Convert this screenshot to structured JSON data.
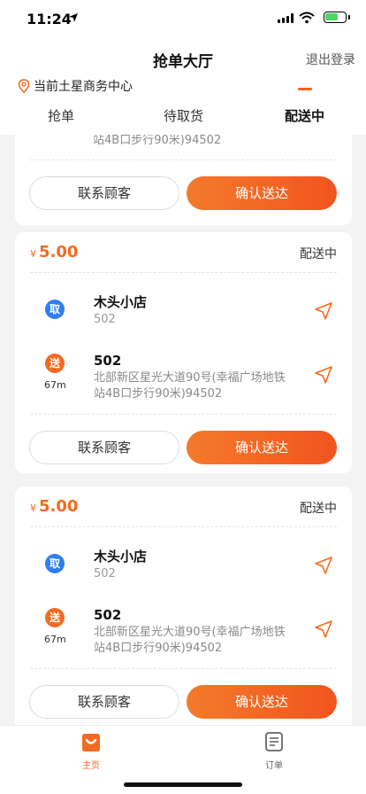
{
  "status_bar": {
    "time": "11:24"
  },
  "header": {
    "title": "抢单大厅",
    "logout_label": "退出登录",
    "location": "当前土星商务中心",
    "tabs": [
      {
        "label": "抢单",
        "active": false
      },
      {
        "label": "待取货",
        "active": false
      },
      {
        "label": "配送中",
        "active": true
      }
    ]
  },
  "partial_card": {
    "address_tail": "站4B口步行90米)94502",
    "contact_label": "联系顾客",
    "confirm_label": "确认送达"
  },
  "orders": [
    {
      "currency": "¥",
      "price": "5.00",
      "status": "配送中",
      "pickup_badge": "取",
      "shop_name": "木头小店",
      "shop_sub": "502",
      "deliver_badge": "送",
      "distance": "67m",
      "dest_name": "502",
      "dest_address_line1": "北部新区星光大道90号(幸福广场地铁",
      "dest_address_line2": "站4B口步行90米)94502",
      "contact_label": "联系顾客",
      "confirm_label": "确认送达"
    },
    {
      "currency": "¥",
      "price": "5.00",
      "status": "配送中",
      "pickup_badge": "取",
      "shop_name": "木头小店",
      "shop_sub": "502",
      "deliver_badge": "送",
      "distance": "67m",
      "dest_name": "502",
      "dest_address_line1": "北部新区星光大道90号(幸福广场地铁",
      "dest_address_line2": "站4B口步行90米)94502",
      "contact_label": "联系顾客",
      "confirm_label": "确认送达"
    }
  ],
  "bottom_nav": {
    "home_label": "主页",
    "orders_label": "订单"
  },
  "colors": {
    "accent": "#f46a22",
    "pickup_blue": "#2f7ff0"
  }
}
